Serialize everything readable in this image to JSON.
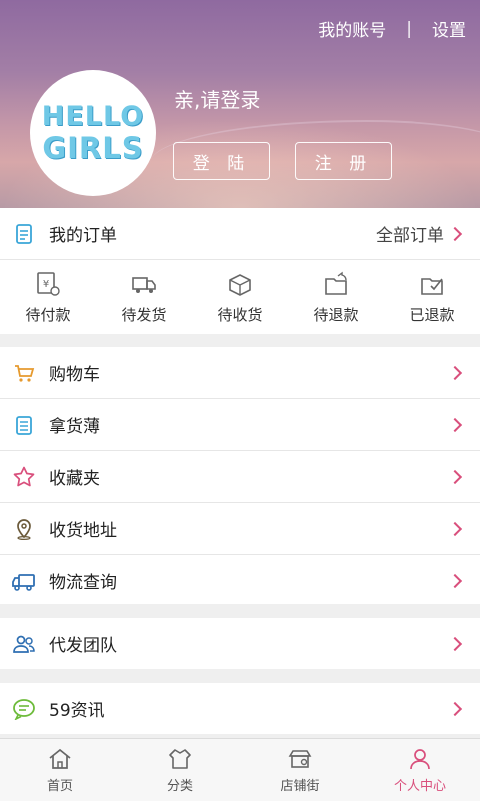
{
  "header": {
    "account_link": "我的账号",
    "separator": "|",
    "settings_link": "设置",
    "avatar_line1": "HELLO",
    "avatar_line2": "GIRLS",
    "greeting": "亲,请登录",
    "login_button": "登 陆",
    "register_button": "注 册"
  },
  "orders": {
    "title": "我的订单",
    "all_orders": "全部订单",
    "statuses": [
      {
        "label": "待付款",
        "icon": "payment-icon"
      },
      {
        "label": "待发货",
        "icon": "truck-icon"
      },
      {
        "label": "待收货",
        "icon": "package-icon"
      },
      {
        "label": "待退款",
        "icon": "refund-icon"
      },
      {
        "label": "已退款",
        "icon": "refunded-icon"
      }
    ]
  },
  "menu": {
    "cart": "购物车",
    "pickup_book": "拿货薄",
    "favorites": "收藏夹",
    "address": "收货地址",
    "logistics": "物流查询",
    "dropship_team": "代发团队",
    "news": "59资讯"
  },
  "bottom_nav": {
    "tabs": [
      {
        "label": "首页",
        "icon": "home-icon"
      },
      {
        "label": "分类",
        "icon": "category-icon"
      },
      {
        "label": "店铺街",
        "icon": "store-icon"
      },
      {
        "label": "个人中心",
        "icon": "user-icon"
      }
    ],
    "active_index": 3
  },
  "colors": {
    "accent": "#d94f7c",
    "chevron": "#d94f7c",
    "active_tab": "#d94f7c"
  }
}
